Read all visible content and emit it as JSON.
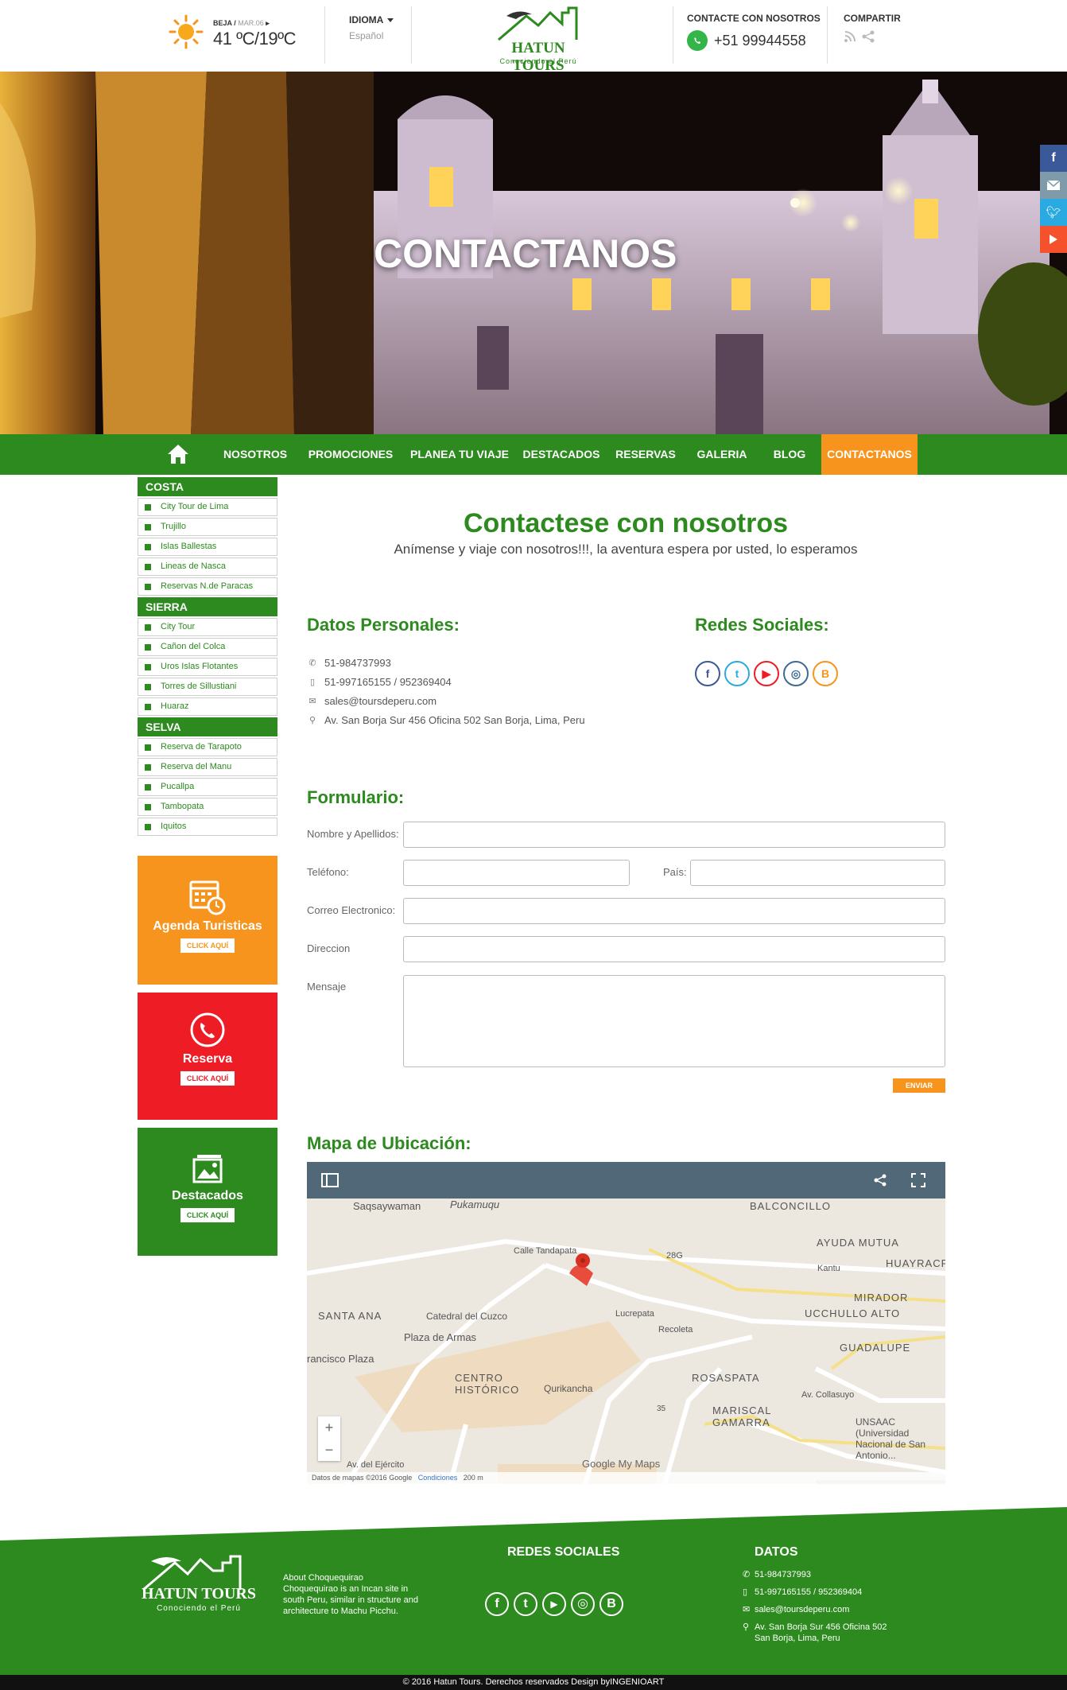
{
  "header": {
    "weather": {
      "location": "BEJA",
      "date": "MAR.06",
      "temp": "41 ºC/19ºC"
    },
    "language": {
      "label": "IDIOMA",
      "value": "Español"
    },
    "logo": {
      "name": "HATUN TOURS",
      "tagline": "Conociendo el Perú"
    },
    "contact": {
      "label": "CONTACTE CON NOSOTROS",
      "phone": "+51 99944558"
    },
    "share": {
      "label": "COMPARTIR"
    }
  },
  "hero": {
    "title": "CONTACTANOS"
  },
  "nav": {
    "items": [
      {
        "label": "NOSOTROS"
      },
      {
        "label": "PROMOCIONES"
      },
      {
        "label": "PLANEA TU VIAJE"
      },
      {
        "label": "DESTACADOS"
      },
      {
        "label": "RESERVAS"
      },
      {
        "label": "GALERIA"
      },
      {
        "label": "BLOG"
      },
      {
        "label": "CONTACTANOS"
      }
    ]
  },
  "sidebar": {
    "costa": {
      "title": "COSTA",
      "items": [
        "City Tour de Lima",
        "Trujillo",
        "Islas Ballestas",
        "Lineas de Nasca",
        "Reservas N.de Paracas"
      ]
    },
    "sierra": {
      "title": "SIERRA",
      "items": [
        "City Tour",
        "Cañon del Colca",
        "Uros Islas Flotantes",
        "Torres de Sillustiani",
        "Huaraz"
      ]
    },
    "selva": {
      "title": "SELVA",
      "items": [
        "Reserva de Tarapoto",
        "Reserva del Manu",
        "Pucallpa",
        "Tambopata",
        "Iquitos"
      ]
    },
    "boxes": [
      {
        "title": "Agenda Turisticas",
        "button": "CLICK AQUÍ",
        "color": "#f7941d"
      },
      {
        "title": "Reserva",
        "button": "CLICK AQUÍ",
        "color": "#ee1c25"
      },
      {
        "title": "Destacados",
        "button": "CLICK AQUÍ",
        "color": "#2d8a1f"
      }
    ]
  },
  "main": {
    "title": "Contactese con nosotros",
    "subtitle": "Anímense y viaje con nosotros!!!, la aventura espera por usted, lo esperamos",
    "datos_title": "Datos Personales:",
    "redes_title": "Redes Sociales:",
    "datos": [
      {
        "icon": "phone-icon",
        "text": "51-984737993"
      },
      {
        "icon": "mobile-icon",
        "text": "51-997165155 / 952369404"
      },
      {
        "icon": "mail-icon",
        "text": "sales@toursdeperu.com"
      },
      {
        "icon": "pin-icon",
        "text": "Av. San Borja Sur 456 Oficina 502 San Borja, Lima, Peru"
      }
    ],
    "form_title": "Formulario:",
    "form": {
      "nombre": "Nombre y Apellidos:",
      "telefono": "Teléfono:",
      "pais": "País:",
      "correo": "Correo Electronico:",
      "direccion": "Direccion",
      "mensaje": "Mensaje",
      "submit": "ENVIAR"
    },
    "map_title": "Mapa de Ubicación:",
    "map": {
      "labels": [
        "Saqsaywaman",
        "Pukamuqu",
        "BALCONCILLO",
        "AYUDA MUTUA",
        "HUAYRACP",
        "Kantu",
        "MIRADOR",
        "UCCHULLO ALTO",
        "GUADALUPE",
        "SANTA ANA",
        "Catedral del Cuzco",
        "Plaza de Armas",
        "rancisco Plaza",
        "CENTRO HISTÓRICO",
        "Qurikancha",
        "ROSASPATA",
        "MARISCAL GAMARRA",
        "UNSAAC (Universidad Nacional de San Antonio...",
        "Calle Tandapata",
        "Lucrepata",
        "Recoleta",
        "Av. Collasuyo",
        "Av. del Ejército",
        "28G",
        "35"
      ],
      "footer": "Datos de mapas ©2016 Google",
      "terms": "Condiciones",
      "scale": "200 m",
      "brand": "Google My Maps"
    }
  },
  "footer": {
    "about_title": "About Choquequirao",
    "about_text": "Choquequirao is an Incan site in south Peru, similar in structure and architecture to Machu Picchu.",
    "redes_title": "REDES SOCIALES",
    "datos_title": "DATOS",
    "datos": [
      "51-984737993",
      "51-997165155 / 952369404",
      "sales@toursdeperu.com",
      "Av. San Borja Sur 456 Oficina 502 San Borja, Lima, Peru"
    ],
    "copyright": "© 2016 Hatun Tours. Derechos reservados Design byINGENIOART"
  },
  "colors": {
    "green": "#2d8a1f",
    "orange": "#f7941d",
    "red": "#ee1c25"
  }
}
